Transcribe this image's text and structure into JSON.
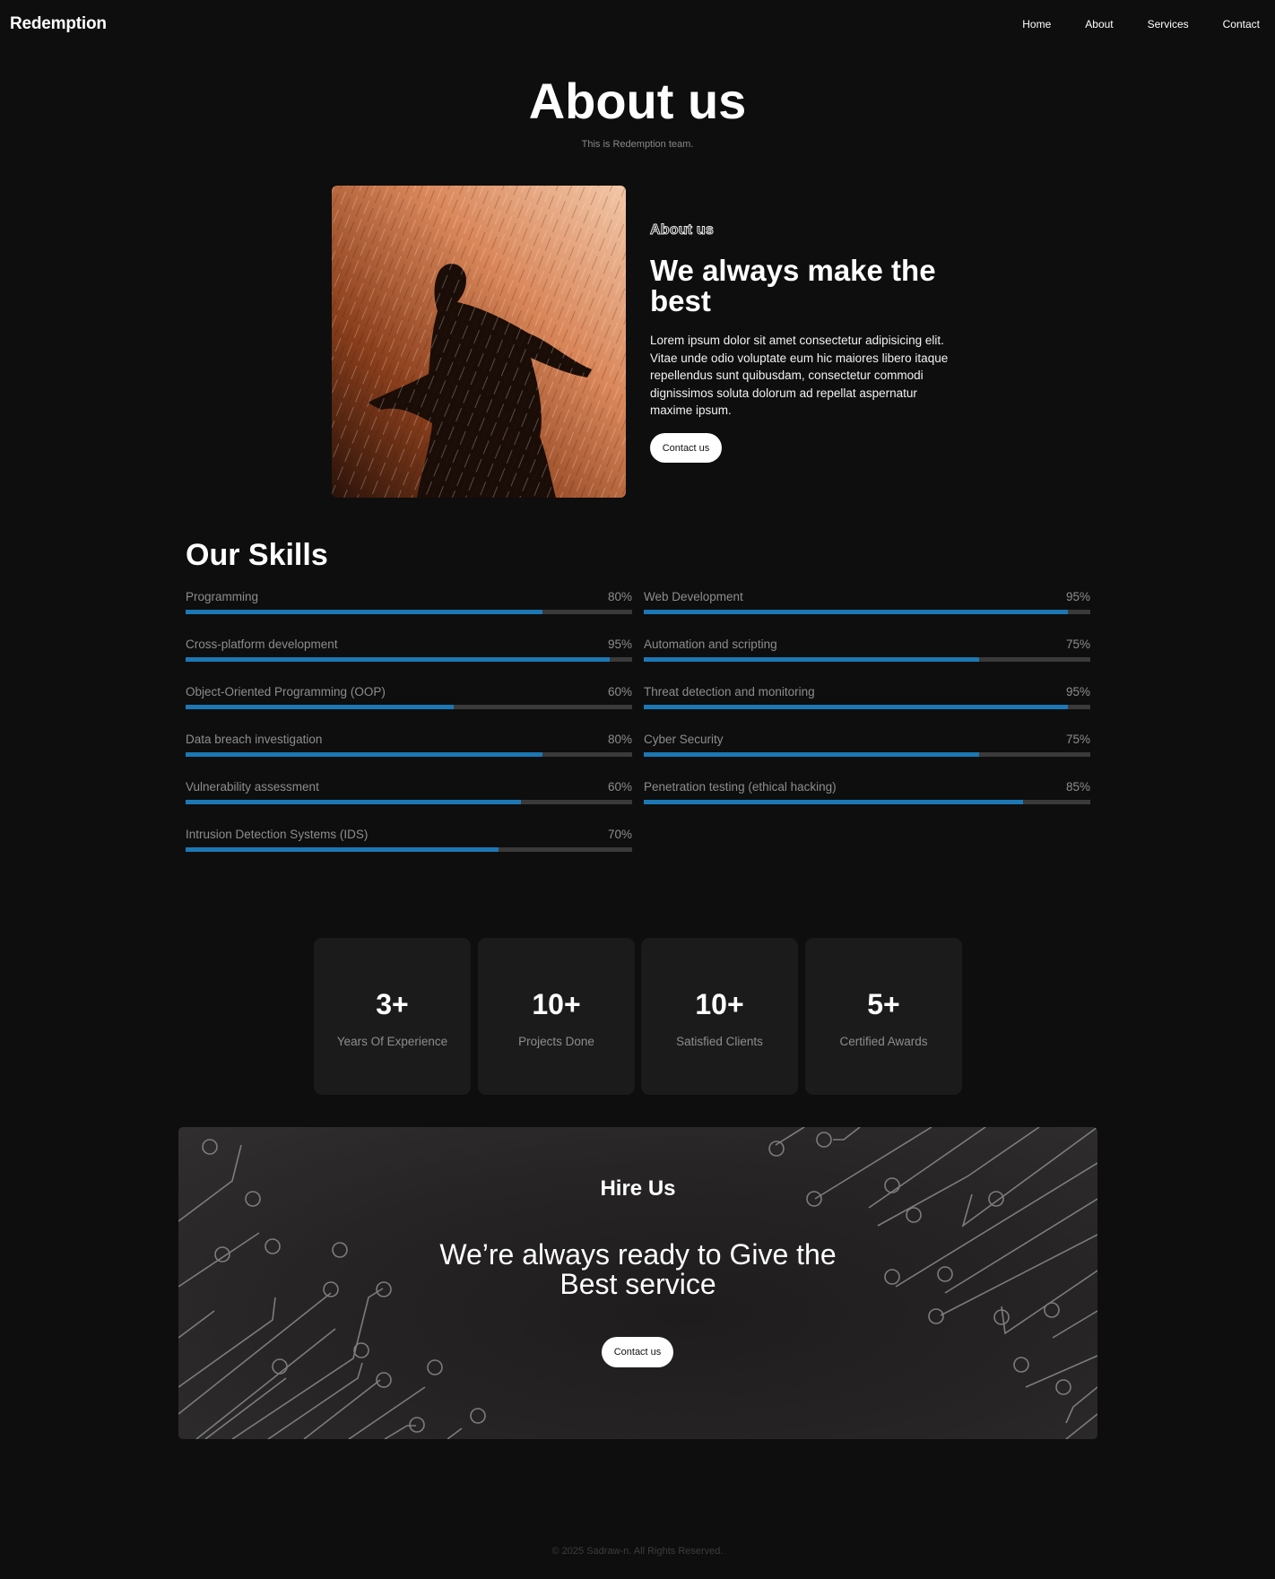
{
  "header": {
    "logo": "Redemption",
    "nav": [
      "Home",
      "About",
      "Services",
      "Contact"
    ]
  },
  "hero": {
    "title": "About us",
    "subtitle": "This is Redemption team."
  },
  "about": {
    "eyebrow": "About us",
    "heading": "We always make the best",
    "text": "Lorem ipsum dolor sit amet consectetur adipisicing elit. Vitae unde odio voluptate eum hic maiores libero itaque repellendus sunt quibusdam, consectetur commodi dignissimos soluta dolorum ad repellat aspernatur maxime ipsum.",
    "button": "Contact us"
  },
  "skills": {
    "title": "Our Skills",
    "left": [
      {
        "name": "Programming",
        "percent": "80%",
        "level": 0.8
      },
      {
        "name": "Cross-platform development",
        "percent": "95%",
        "level": 0.95
      },
      {
        "name": "Object-Oriented Programming (OOP)",
        "percent": "60%",
        "level": 0.6
      },
      {
        "name": "Data breach investigation",
        "percent": "80%",
        "level": 0.8
      },
      {
        "name": "Vulnerability assessment",
        "percent": "60%",
        "level": 0.75
      },
      {
        "name": "Intrusion Detection Systems (IDS)",
        "percent": "70%",
        "level": 0.7
      }
    ],
    "right": [
      {
        "name": "Web Development",
        "percent": "95%",
        "level": 0.95
      },
      {
        "name": "Automation and scripting",
        "percent": "75%",
        "level": 0.75
      },
      {
        "name": "Threat detection and monitoring",
        "percent": "95%",
        "level": 0.95
      },
      {
        "name": "Cyber Security",
        "percent": "75%",
        "level": 0.75
      },
      {
        "name": "Penetration testing (ethical hacking)",
        "percent": "85%",
        "level": 0.85
      }
    ],
    "bar_color": "#1c78b5"
  },
  "stats": [
    {
      "value": "3+",
      "label": "Years Of Experience"
    },
    {
      "value": "10+",
      "label": "Projects Done"
    },
    {
      "value": "10+",
      "label": "Satisfied Clients"
    },
    {
      "value": "5+",
      "label": "Certified Awards"
    }
  ],
  "hire": {
    "title": "Hire Us",
    "text_line1": "We’re always ready to Give the",
    "text_line2": "Best service",
    "button": "Contact us"
  },
  "footer": {
    "copyright": "© 2025 Sadraw-n. All Rights Reserved."
  }
}
